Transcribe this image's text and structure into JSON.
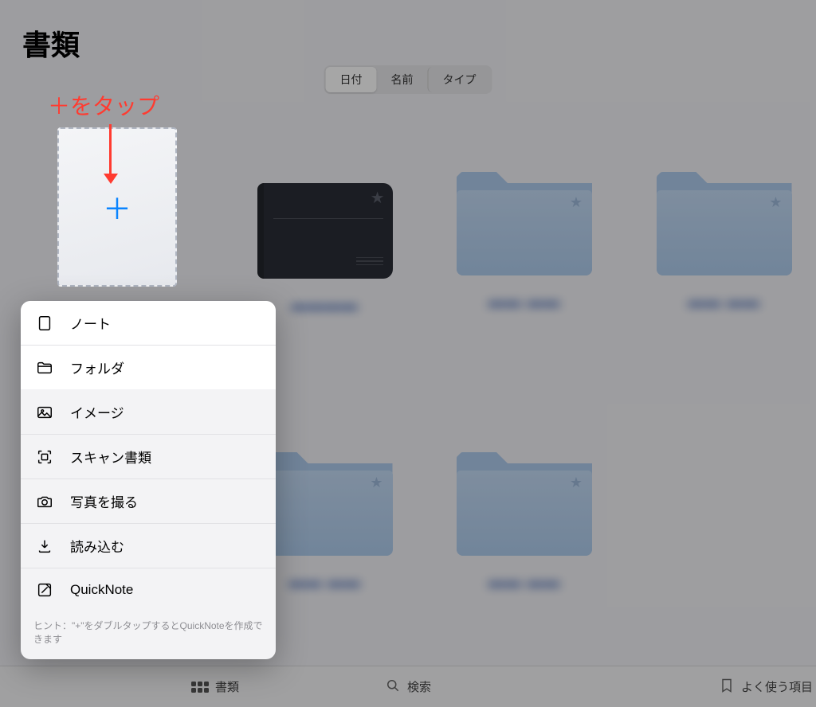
{
  "header": {
    "title": "書類"
  },
  "segmented": {
    "date": "日付",
    "name": "名前",
    "type": "タイプ"
  },
  "annotation": {
    "text": "＋をタップ"
  },
  "items": {
    "label1": "▬▬▬▬",
    "label2": "▬▬ ▬▬",
    "label3": "▬▬ ▬▬",
    "label4": "▬▬▬▬",
    "label5": "▬▬ ▬▬",
    "label6": "▬▬ ▬▬"
  },
  "menu": {
    "note": "ノート",
    "folder": "フォルダ",
    "image": "イメージ",
    "scan": "スキャン書類",
    "camera": "写真を撮る",
    "import": "読み込む",
    "quicknote": "QuickNote",
    "hint": "ヒント：\"+\"をダブルタップするとQuickNoteを作成できます"
  },
  "toolbar": {
    "documents": "書類",
    "search": "検索",
    "favorites": "よく使う項目"
  }
}
